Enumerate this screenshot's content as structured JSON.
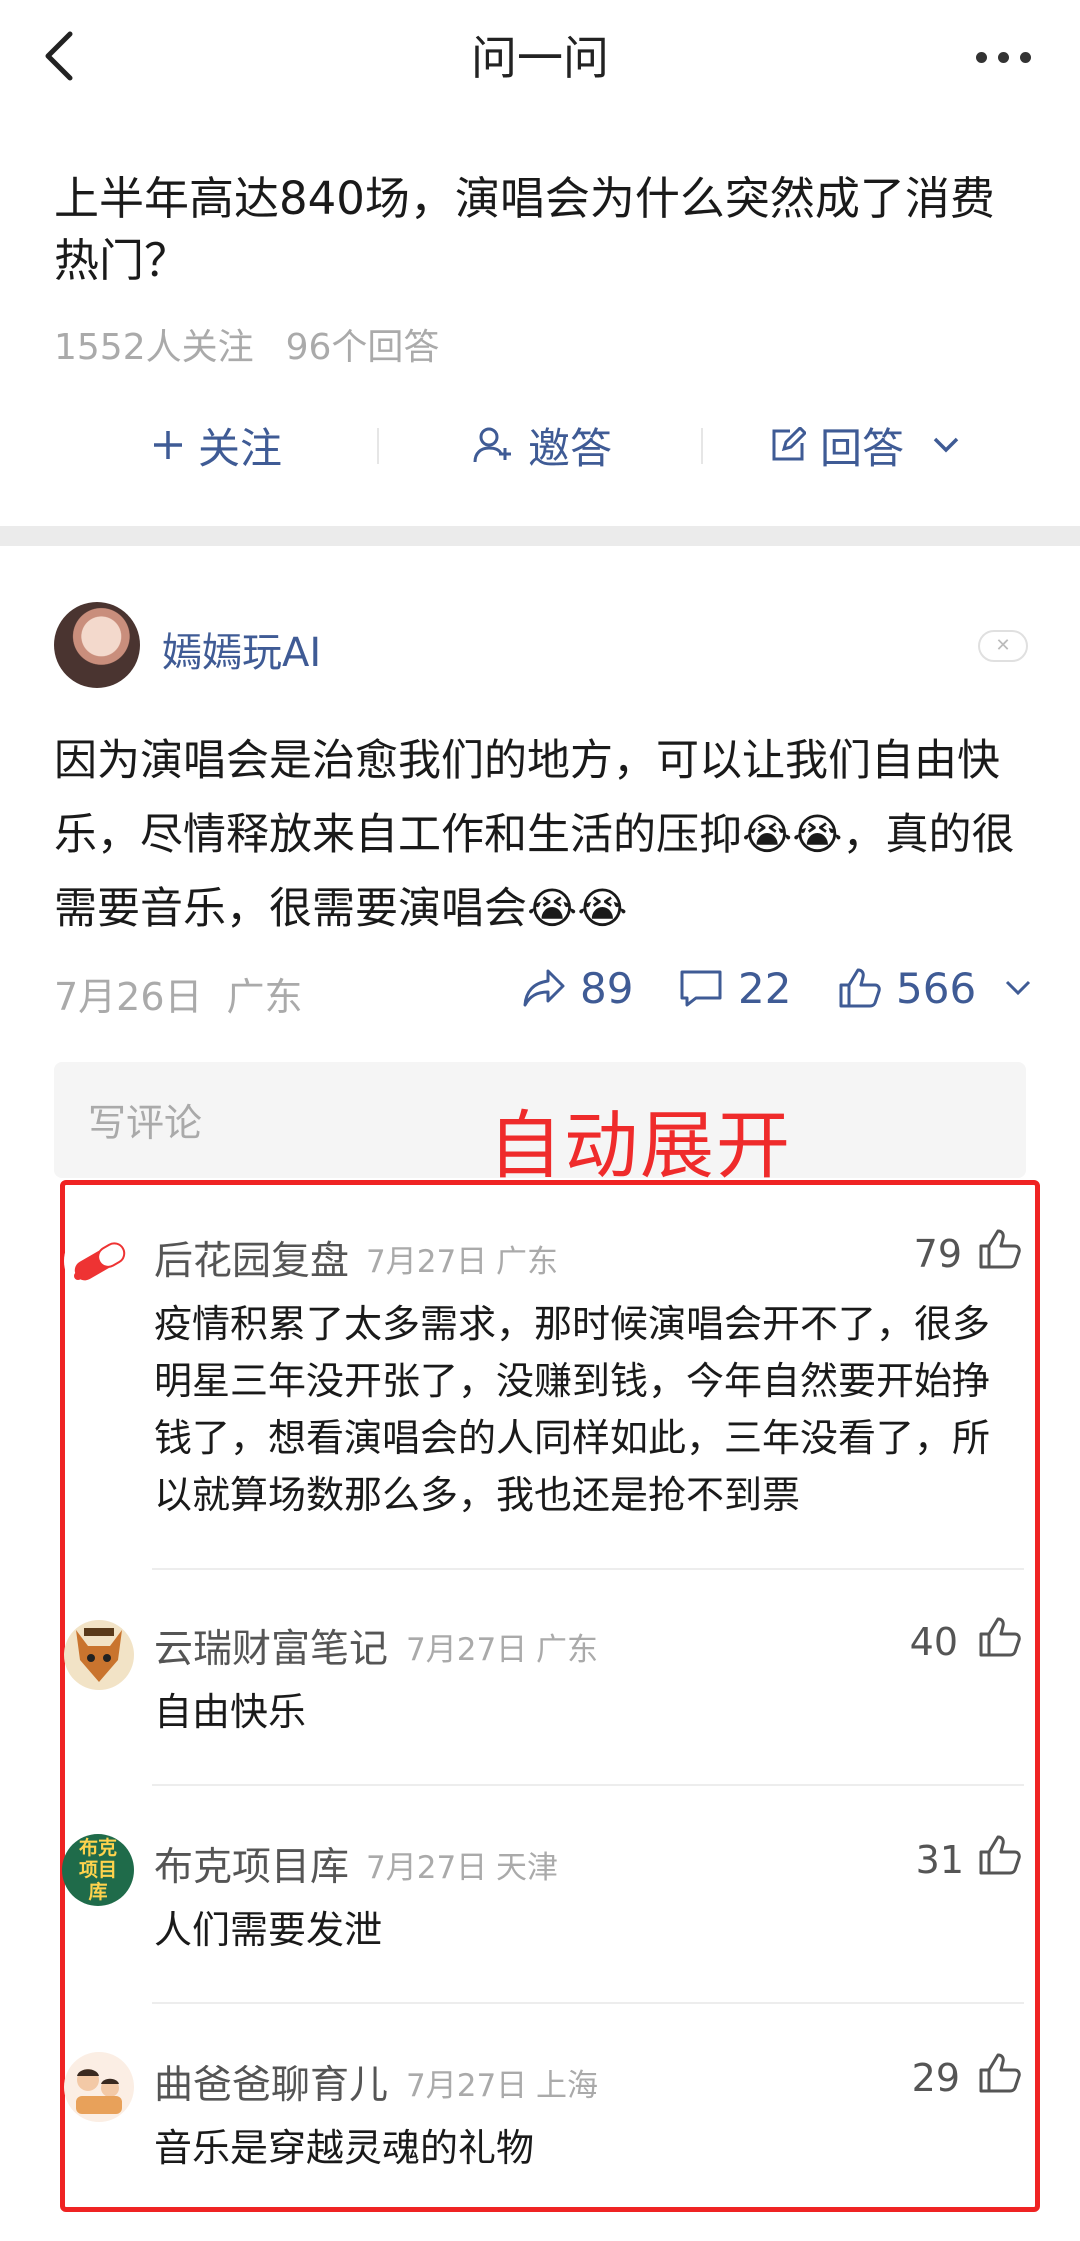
{
  "nav": {
    "title": "问一问"
  },
  "question": {
    "title": "上半年高达840场，演唱会为什么突然成了消费热门？",
    "followers": "1552人关注",
    "answers": "96个回答",
    "actions": {
      "follow": "关注",
      "invite": "邀答",
      "answer": "回答"
    }
  },
  "answer": {
    "author": "嫣嫣玩AI",
    "text": "因为演唱会是治愈我们的地方，可以让我们自由快乐，尽情释放来自工作和生活的压抑😭😭，真的很需要音乐，很需要演唱会😭😭",
    "date": "7月26日",
    "location": "广东",
    "shares": "89",
    "comments": "22",
    "likes": "566"
  },
  "comment_input": {
    "placeholder": "写评论"
  },
  "annotation": "自动展开",
  "comments": [
    {
      "name": "后花园复盘",
      "date": "7月27日",
      "location": "广东",
      "likes": "79",
      "text": "疫情积累了太多需求，那时候演唱会开不了，很多明星三年没开张了，没赚到钱，今年自然要开始挣钱了，想看演唱会的人同样如此，三年没看了，所以就算场数那么多，我也还是抢不到票"
    },
    {
      "name": "云瑞财富笔记",
      "date": "7月27日",
      "location": "广东",
      "likes": "40",
      "text": "自由快乐"
    },
    {
      "name": "布克项目库",
      "date": "7月27日",
      "location": "天津",
      "likes": "31",
      "text": "人们需要发泄",
      "avatar_text": "布克项目库"
    },
    {
      "name": "曲爸爸聊育儿",
      "date": "7月27日",
      "location": "上海",
      "likes": "29",
      "text": "音乐是穿越灵魂的礼物"
    }
  ],
  "colors": {
    "link_blue": "#3f5b95",
    "annotation_red": "#ef2b2b",
    "meta_gray": "#aaaaaa"
  }
}
